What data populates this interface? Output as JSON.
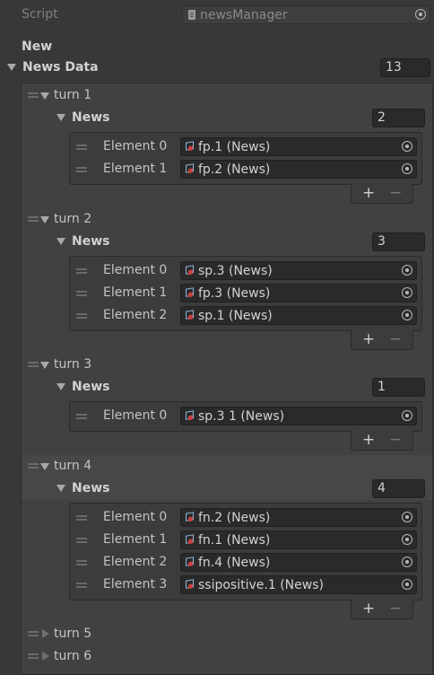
{
  "script": {
    "label": "Script",
    "value": "newsManager"
  },
  "new_label": "New",
  "news_data": {
    "label": "News Data",
    "size": "13"
  },
  "turns": [
    {
      "label": "turn 1",
      "news_label": "News",
      "count": "2",
      "elements": [
        {
          "label": "Element 0",
          "value": "fp.1 (News)"
        },
        {
          "label": "Element 1",
          "value": "fp.2 (News)"
        }
      ]
    },
    {
      "label": "turn 2",
      "news_label": "News",
      "count": "3",
      "elements": [
        {
          "label": "Element 0",
          "value": "sp.3 (News)"
        },
        {
          "label": "Element 1",
          "value": "fp.3 (News)"
        },
        {
          "label": "Element 2",
          "value": "sp.1 (News)"
        }
      ]
    },
    {
      "label": "turn 3",
      "news_label": "News",
      "count": "1",
      "elements": [
        {
          "label": "Element 0",
          "value": "sp.3 1 (News)"
        }
      ]
    },
    {
      "label": "turn 4",
      "news_label": "News",
      "count": "4",
      "elements": [
        {
          "label": "Element 0",
          "value": "fn.2 (News)"
        },
        {
          "label": "Element 1",
          "value": "fn.1 (News)"
        },
        {
          "label": "Element 2",
          "value": "fn.4 (News)"
        },
        {
          "label": "Element 3",
          "value": "ssipositive.1 (News)"
        }
      ]
    }
  ],
  "collapsed_turns": [
    {
      "label": "turn 5"
    },
    {
      "label": "turn 6"
    }
  ],
  "buttons": {
    "add": "+",
    "remove": "−"
  }
}
